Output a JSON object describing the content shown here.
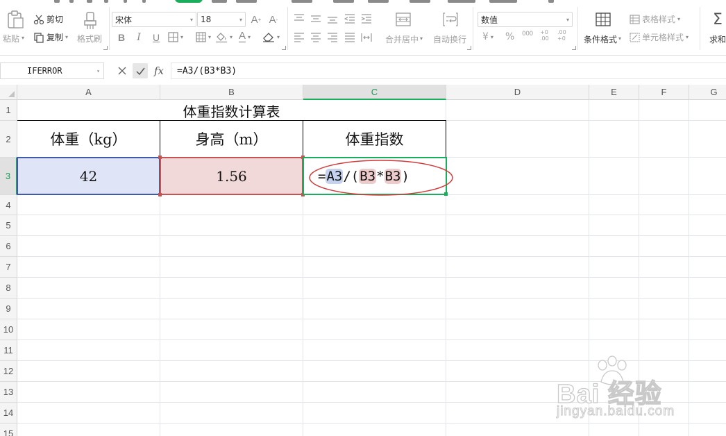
{
  "ribbon": {
    "paste_label": "粘贴",
    "cut_label": "剪切",
    "copy_label": "复制",
    "format_painter_label": "格式刷",
    "font_name": "宋体",
    "font_size": "18",
    "bold": "B",
    "italic": "I",
    "underline": "U",
    "grow_font": "A⁺",
    "shrink_font": "A⁻",
    "merge_center_label": "合并居中",
    "wrap_text_label": "自动换行",
    "number_format": "数值",
    "currency_symbol": "¥",
    "percent_symbol": "%",
    "thousands_symbol": "000",
    "increase_decimal": "+0 .00",
    "decrease_decimal": ".00 +0",
    "conditional_format_label": "条件格式",
    "table_style_label": "表格样式",
    "cell_style_label": "单元格样式",
    "sum_label": "求和"
  },
  "formula_bar": {
    "name_box": "IFERROR",
    "fx_label": "fx",
    "formula": "=A3/(B3*B3)"
  },
  "grid": {
    "columns": [
      "A",
      "B",
      "C",
      "D",
      "E",
      "F",
      "G"
    ],
    "active_column": "C",
    "rows": [
      "1",
      "2",
      "3",
      "4",
      "5",
      "6",
      "7",
      "8",
      "9",
      "10",
      "11",
      "12",
      "13",
      "14",
      "15"
    ],
    "active_row": "3",
    "title": "体重指数计算表",
    "headers": [
      "体重（kg）",
      "身高（m）",
      "体重指数"
    ],
    "values": {
      "a3": "42",
      "b3": "1.56"
    },
    "c3_formula": {
      "eq": "=",
      "ref1": "A3",
      "op1": "/(",
      "ref2": "B3",
      "op2": "*",
      "ref3": "B3",
      "close": ")"
    }
  },
  "watermark": {
    "logo_text": "Bai 经验",
    "url": "jingyan.baidu.com"
  },
  "colors": {
    "accent_green": "#1aad5b",
    "ref_blue": "#3f5aa8",
    "ref_red": "#c45454",
    "annotation_red": "#d33a3a"
  }
}
